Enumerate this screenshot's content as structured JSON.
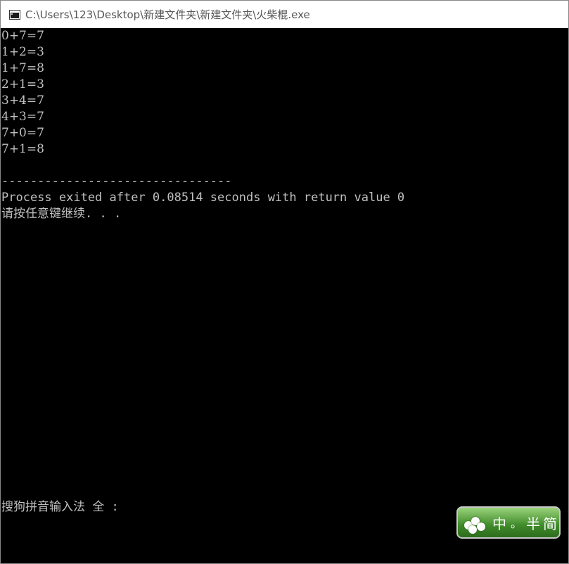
{
  "window": {
    "title": "C:\\Users\\123\\Desktop\\新建文件夹\\新建文件夹\\火柴棍.exe"
  },
  "console": {
    "result_lines": [
      "0+7=7",
      "1+2=3",
      "1+7=8",
      "2+1=3",
      "3+4=7",
      "4+3=7",
      "7+0=7",
      "7+1=8"
    ],
    "separator": "--------------------------------",
    "process_line": "Process exited after 0.08514 seconds with return value 0",
    "prompt_line": "请按任意键继续. . .",
    "ime_status_line": "搜狗拼音输入法 全 :"
  },
  "ime_panel": {
    "mode_label": "中",
    "punct_label": "。",
    "width_label": "半",
    "charset_label": "简",
    "logo_icon": "sogou-flower-icon"
  }
}
